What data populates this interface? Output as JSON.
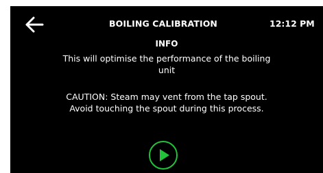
{
  "header": {
    "title": "BOILING CALIBRATION",
    "time": "12:12 PM"
  },
  "content": {
    "heading": "INFO",
    "description_line1": "This will optimise the performance of the boiling",
    "description_line2": "unit",
    "caution_line1": "CAUTION: Steam may vent from the tap spout.",
    "caution_line2": "Avoid touching the spout during this process."
  },
  "icons": {
    "back": "arrow-left-icon",
    "play": "play-icon"
  },
  "colors": {
    "background": "#000000",
    "text": "#ffffff",
    "accent": "#22c33a"
  }
}
